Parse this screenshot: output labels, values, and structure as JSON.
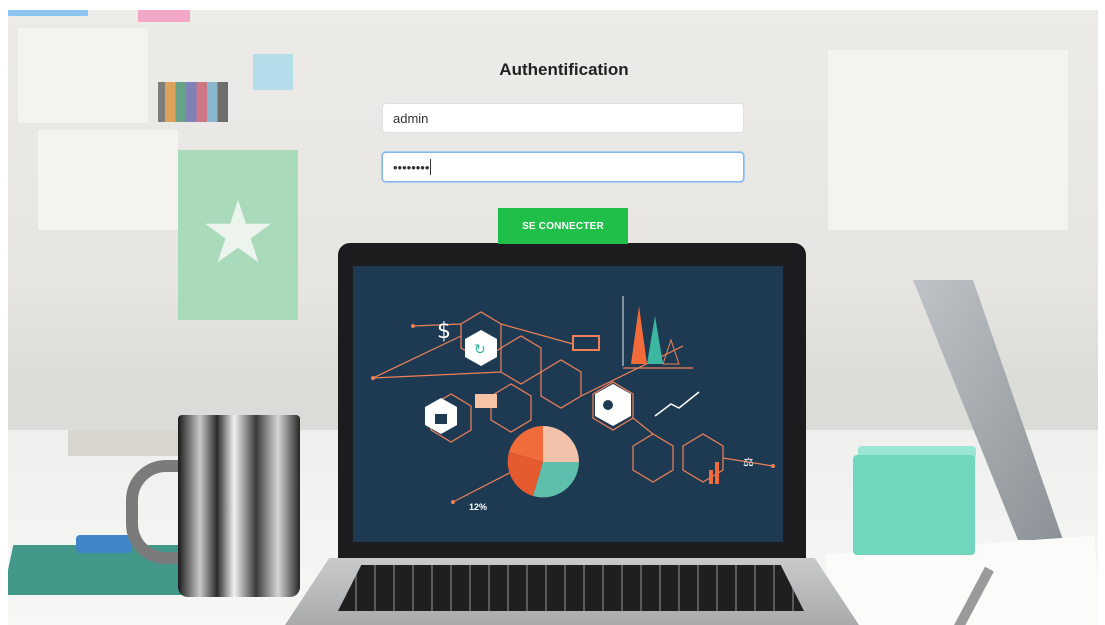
{
  "title": "Authentification",
  "username_input": {
    "value": "admin",
    "placeholder": ""
  },
  "password_input": {
    "masked_value": "••••••••",
    "placeholder": ""
  },
  "login_button": {
    "label": "SE CONNECTER"
  },
  "background_scene": {
    "screen_annotation": "12%"
  },
  "colors": {
    "button": "#1fbf4a",
    "focused_border": "#86b7e6",
    "screen_bg": "#1d3a52"
  },
  "icons": [
    "dollar-icon",
    "refresh-icon",
    "money-icon",
    "lock-icon",
    "card-icon",
    "key-icon",
    "chart-icon",
    "scale-icon",
    "pie-icon"
  ]
}
